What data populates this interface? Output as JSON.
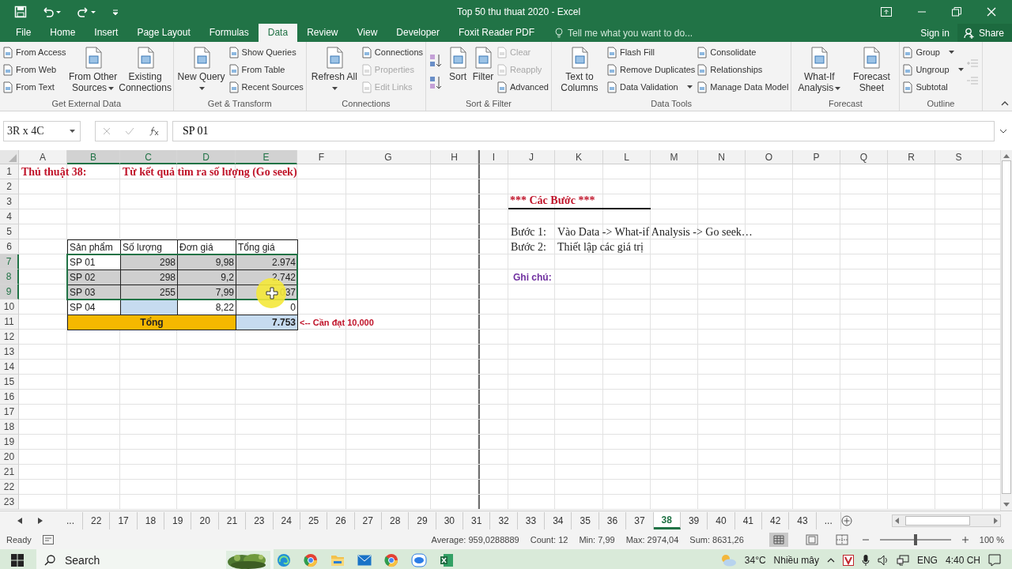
{
  "window": {
    "title": "Top 50 thu thuat 2020 - Excel"
  },
  "tabs": [
    {
      "label": "File",
      "selected": false
    },
    {
      "label": "Home",
      "selected": false
    },
    {
      "label": "Insert",
      "selected": false
    },
    {
      "label": "Page Layout",
      "selected": false
    },
    {
      "label": "Formulas",
      "selected": false
    },
    {
      "label": "Data",
      "selected": true
    },
    {
      "label": "Review",
      "selected": false
    },
    {
      "label": "View",
      "selected": false
    },
    {
      "label": "Developer",
      "selected": false
    },
    {
      "label": "Foxit Reader PDF",
      "selected": false
    }
  ],
  "tell_me": {
    "placeholder": "Tell me what you want to do..."
  },
  "account": {
    "sign_in": "Sign in",
    "share": "Share"
  },
  "ribbon": [
    {
      "name": "Get External Data",
      "items": [
        {
          "kind": "stack",
          "items": [
            {
              "label": "From Access",
              "disabled": false
            },
            {
              "label": "From Web",
              "disabled": false
            },
            {
              "label": "From Text",
              "disabled": false
            }
          ]
        },
        {
          "kind": "large",
          "label": "From Other Sources",
          "dropdown": true
        },
        {
          "kind": "large",
          "label": "Existing Connections",
          "dropdown": false
        }
      ]
    },
    {
      "name": "Get & Transform",
      "items": [
        {
          "kind": "large",
          "label": "New Query",
          "dropdown": true
        },
        {
          "kind": "stack",
          "items": [
            {
              "label": "Show Queries",
              "disabled": false
            },
            {
              "label": "From Table",
              "disabled": false
            },
            {
              "label": "Recent Sources",
              "disabled": false
            }
          ]
        }
      ]
    },
    {
      "name": "Connections",
      "items": [
        {
          "kind": "large",
          "label": "Refresh All",
          "dropdown": true
        },
        {
          "kind": "stack",
          "items": [
            {
              "label": "Connections",
              "disabled": false
            },
            {
              "label": "Properties",
              "disabled": true
            },
            {
              "label": "Edit Links",
              "disabled": true
            }
          ]
        }
      ]
    },
    {
      "name": "Sort & Filter",
      "items": [
        {
          "kind": "sort-icons"
        },
        {
          "kind": "large",
          "label": "Sort",
          "dropdown": false
        },
        {
          "kind": "large",
          "label": "Filter",
          "dropdown": false
        },
        {
          "kind": "stack",
          "items": [
            {
              "label": "Clear",
              "disabled": true
            },
            {
              "label": "Reapply",
              "disabled": true
            },
            {
              "label": "Advanced",
              "disabled": false
            }
          ]
        }
      ]
    },
    {
      "name": "Data Tools",
      "items": [
        {
          "kind": "large",
          "label": "Text to Columns",
          "dropdown": false
        },
        {
          "kind": "stack",
          "items": [
            {
              "label": "Flash Fill",
              "disabled": false
            },
            {
              "label": "Remove Duplicates",
              "disabled": false
            },
            {
              "label": "Data Validation",
              "disabled": false,
              "dropdown": true
            }
          ]
        },
        {
          "kind": "stack",
          "items": [
            {
              "label": "Consolidate",
              "disabled": false
            },
            {
              "label": "Relationships",
              "disabled": false
            },
            {
              "label": "Manage Data Model",
              "disabled": false
            }
          ]
        }
      ]
    },
    {
      "name": "Forecast",
      "items": [
        {
          "kind": "large",
          "label": "What-If Analysis",
          "dropdown": true
        },
        {
          "kind": "large",
          "label": "Forecast Sheet",
          "dropdown": false
        }
      ]
    },
    {
      "name": "Outline",
      "items": [
        {
          "kind": "stack",
          "items": [
            {
              "label": "Group",
              "disabled": false,
              "dropdown": true
            },
            {
              "label": "Ungroup",
              "disabled": false,
              "dropdown": true
            },
            {
              "label": "Subtotal",
              "disabled": false
            }
          ]
        },
        {
          "kind": "detail-icons"
        }
      ]
    }
  ],
  "formula_bar": {
    "name_box": "3R x 4C",
    "value": "SP 01"
  },
  "sheet": {
    "columns": [
      "A",
      "B",
      "C",
      "D",
      "E",
      "F",
      "G",
      "H",
      "I",
      "J",
      "K",
      "L",
      "M",
      "N",
      "O",
      "P",
      "Q",
      "R",
      "S"
    ],
    "rows": [
      "1",
      "2",
      "3",
      "4",
      "5",
      "6",
      "7",
      "8",
      "9",
      "10",
      "11",
      "12",
      "13",
      "14",
      "15",
      "16",
      "17",
      "18",
      "19",
      "20",
      "21",
      "22",
      "23"
    ],
    "title_label": "Thủ thuật 38:",
    "title": "Từ kết quả tìm ra số lượng (Go seek)"
  },
  "table": {
    "columns": [
      "Sản phẩm",
      "Số lượng",
      "Đơn giá",
      "Tổng giá"
    ],
    "rows": [
      {
        "product": "SP 01",
        "quantity": "298",
        "price": "9,98",
        "total": "2.974",
        "selected": true
      },
      {
        "product": "SP 02",
        "quantity": "298",
        "price": "9,2",
        "total": "2.742",
        "selected": true
      },
      {
        "product": "SP 03",
        "quantity": "255",
        "price": "7,99",
        "total": "037",
        "selected": true
      },
      {
        "product": "SP 04",
        "price": "8,22",
        "total": "0",
        "selected": false
      }
    ],
    "total_label": "Tổng",
    "total_value": "7.753",
    "target_note": "<-- Cần đạt 10,000"
  },
  "steps": {
    "heading": "*** Các Bước ***",
    "items": [
      {
        "label": "Bước 1:",
        "text": "Vào Data -> What-if Analysis -> Go seek…"
      },
      {
        "label": "Bước 2:",
        "text": "Thiết lập các giá trị"
      }
    ],
    "note_label": "Ghi chú:"
  },
  "sheet_tabs": {
    "more_left": "...",
    "tabs": [
      {
        "label": "22",
        "selected": false
      },
      {
        "label": "17",
        "selected": false
      },
      {
        "label": "18",
        "selected": false
      },
      {
        "label": "19",
        "selected": false
      },
      {
        "label": "20",
        "selected": false
      },
      {
        "label": "21",
        "selected": false
      },
      {
        "label": "23",
        "selected": false
      },
      {
        "label": "24",
        "selected": false
      },
      {
        "label": "25",
        "selected": false
      },
      {
        "label": "26",
        "selected": false
      },
      {
        "label": "27",
        "selected": false
      },
      {
        "label": "28",
        "selected": false
      },
      {
        "label": "29",
        "selected": false
      },
      {
        "label": "30",
        "selected": false
      },
      {
        "label": "31",
        "selected": false
      },
      {
        "label": "32",
        "selected": false
      },
      {
        "label": "33",
        "selected": false
      },
      {
        "label": "34",
        "selected": false
      },
      {
        "label": "35",
        "selected": false
      },
      {
        "label": "36",
        "selected": false
      },
      {
        "label": "37",
        "selected": false
      },
      {
        "label": "38",
        "selected": true
      },
      {
        "label": "39",
        "selected": false
      },
      {
        "label": "40",
        "selected": false
      },
      {
        "label": "41",
        "selected": false
      },
      {
        "label": "42",
        "selected": false
      },
      {
        "label": "43",
        "selected": false
      }
    ],
    "more_right": "..."
  },
  "status_bar": {
    "mode": "Ready",
    "stats": [
      "Average: 959,0288889",
      "Count: 12",
      "Min: 7,99",
      "Max: 2974,04",
      "Sum: 8631,26"
    ],
    "zoom_slider": {
      "level": 0.5
    },
    "zoom": "100 %"
  },
  "taskbar": {
    "search": "Search",
    "temperature": "34°C",
    "weather": "Nhiều mây",
    "language": "ENG",
    "time": "4:40 CH"
  }
}
